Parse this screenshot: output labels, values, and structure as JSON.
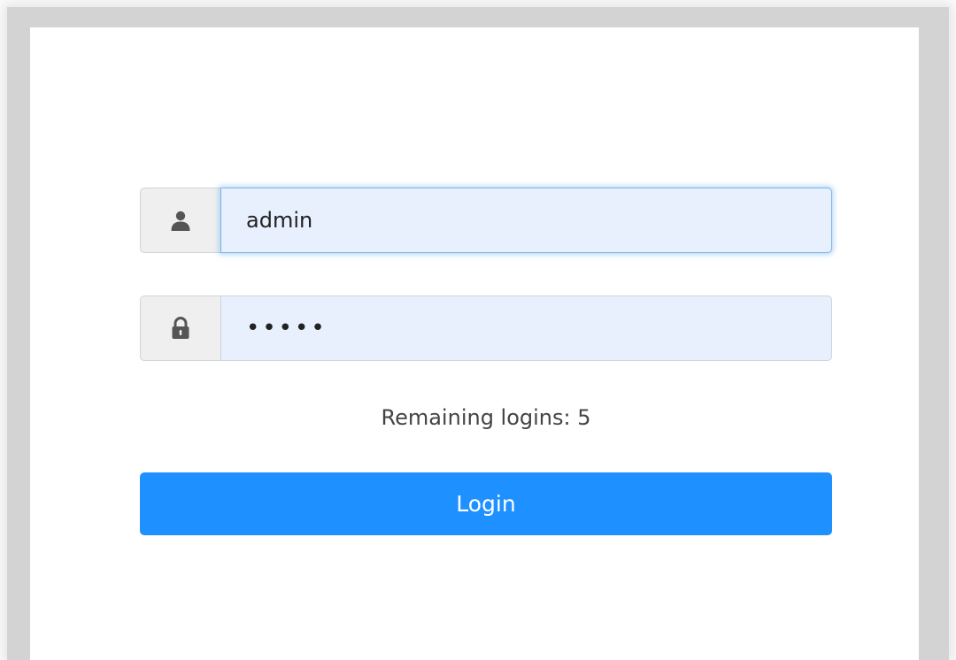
{
  "login_form": {
    "username": {
      "value": "admin",
      "icon": "user-icon"
    },
    "password": {
      "value": "•••••",
      "icon": "lock-icon"
    },
    "remaining_logins": "Remaining logins: 5",
    "login_button": "Login"
  },
  "colors": {
    "accent": "#1e90ff",
    "input_background": "#e8f0fe",
    "addon_background": "#efefef"
  }
}
